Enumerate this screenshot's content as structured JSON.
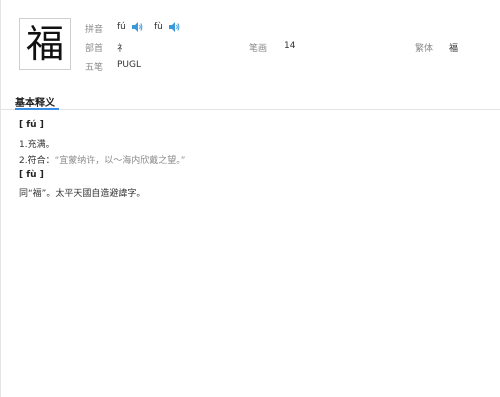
{
  "character": "福",
  "info": {
    "pinyin_label": "拼音",
    "pinyin_1": "fú",
    "pinyin_2": "fù",
    "radical_label": "部首",
    "radical_value": "礻",
    "strokes_label": "笔画",
    "strokes_value": "14",
    "traditional_label": "繁体",
    "traditional_value": "福",
    "wubi_label": "五笔",
    "wubi_value": "PUGL"
  },
  "tab": {
    "label": "基本释义"
  },
  "definitions": {
    "head_1": "[ fú ]",
    "item_1": "1.充满。",
    "item_2_text": "2.符合：",
    "item_2_example": "“宜蒙纳许，以～海内欣戴之望。”",
    "head_2": "[ fù ]",
    "item_3": "同“福”。太平天國自造避諱字。"
  },
  "colors": {
    "accent": "#3a8ee6",
    "speaker": "#3a9ad9"
  }
}
